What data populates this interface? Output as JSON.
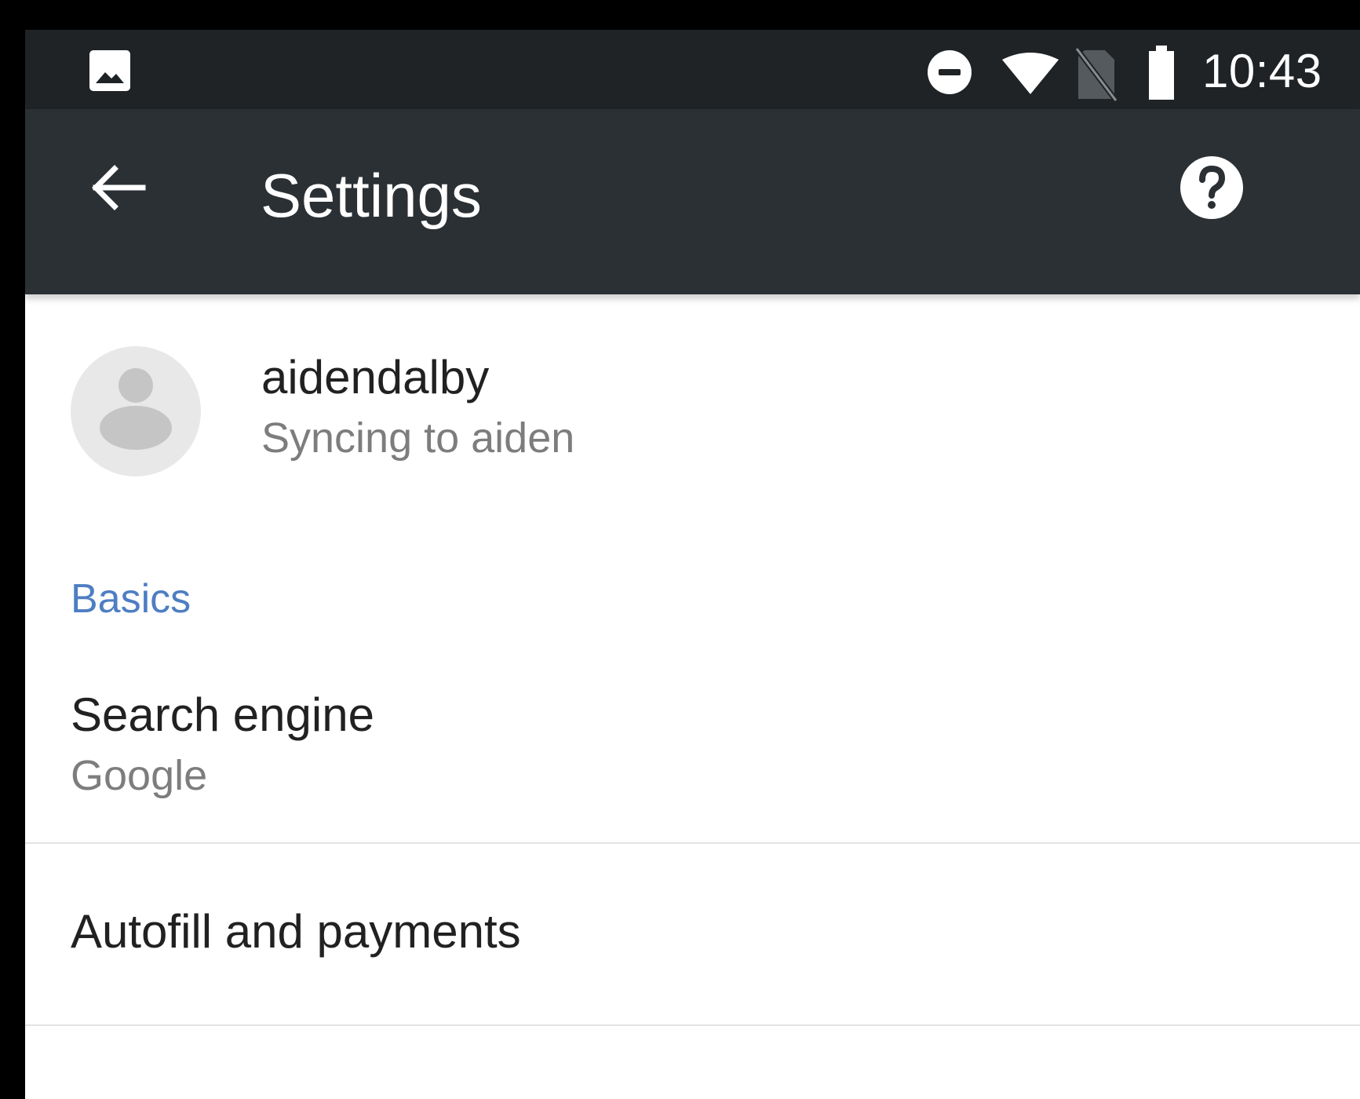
{
  "status_bar": {
    "time": "10:43",
    "icons": [
      "gallery-icon",
      "do-not-disturb-icon",
      "wifi-icon",
      "no-sim-icon",
      "battery-icon"
    ]
  },
  "app_bar": {
    "title": "Settings",
    "back_icon": "arrow-back-icon",
    "help_icon": "help-icon"
  },
  "account": {
    "name": "aidendalby",
    "subtitle": "Syncing to aiden",
    "avatar_icon": "person-avatar-icon"
  },
  "sections": {
    "basics": {
      "header": "Basics",
      "items": [
        {
          "title": "Search engine",
          "summary": "Google"
        },
        {
          "title": "Autofill and payments"
        }
      ]
    }
  },
  "colors": {
    "status_bar": "#1f2326",
    "app_bar": "#2b3034",
    "accent": "#4e7ec2",
    "background": "#ffffff",
    "divider": "#e3e3e3"
  }
}
